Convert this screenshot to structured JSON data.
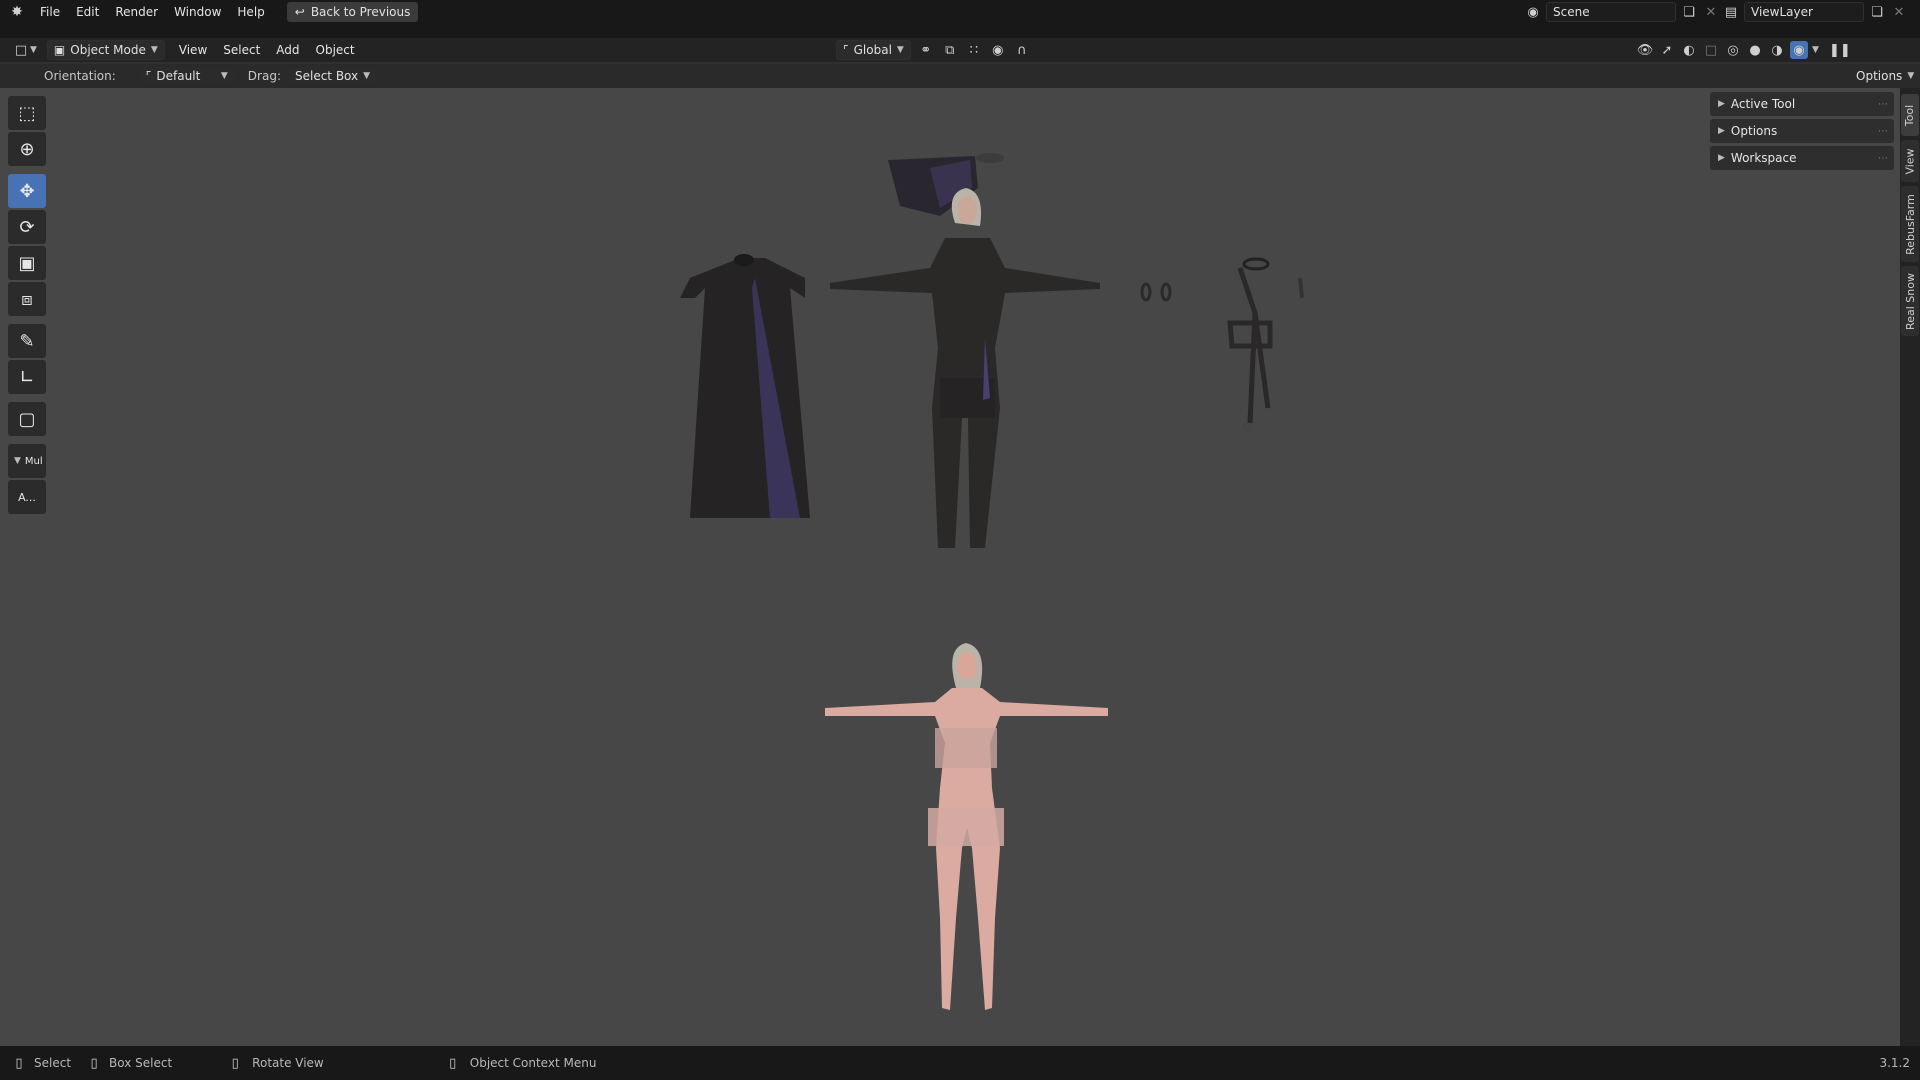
{
  "topbar": {
    "menus": [
      "File",
      "Edit",
      "Render",
      "Window",
      "Help"
    ],
    "back_button": "Back to Previous",
    "scene_name": "Scene",
    "viewlayer_name": "ViewLayer"
  },
  "header": {
    "mode": "Object Mode",
    "menus": [
      "View",
      "Select",
      "Add",
      "Object"
    ],
    "transform_orientation": "Global"
  },
  "tool_header": {
    "orientation_label": "Orientation:",
    "orientation_value": "Default",
    "drag_label": "Drag:",
    "drag_value": "Select Box",
    "options": "Options"
  },
  "toolbar": {
    "collapsed_label": "Mul",
    "small_button": "A..."
  },
  "npanel": {
    "sections": [
      "Active Tool",
      "Options",
      "Workspace"
    ],
    "tabs": [
      "Tool",
      "View",
      "RebusFarm",
      "Real Snow"
    ]
  },
  "statusbar": {
    "select": "Select",
    "box_select": "Box Select",
    "rotate_view": "Rotate View",
    "context_menu": "Object Context Menu",
    "version": "3.1.2"
  },
  "colors": {
    "accent": "#4772b3",
    "viewport": "#474747"
  }
}
